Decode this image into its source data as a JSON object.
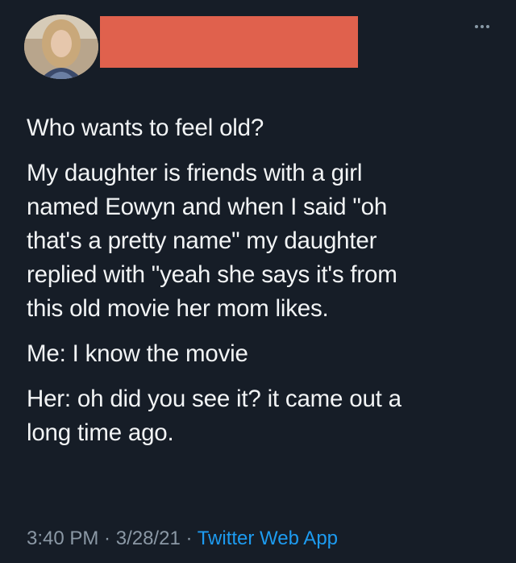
{
  "tweet": {
    "paragraphs": [
      "Who wants to feel old?",
      "My daughter is friends with a girl\nnamed Eowyn and when I said \"oh\nthat's a pretty name\" my daughter\nreplied with \"yeah she says it's from\nthis old movie her mom likes.",
      "Me: I know the movie",
      "Her: oh did you see it? it came out a\nlong time ago."
    ],
    "time": "3:40 PM",
    "separator": " · ",
    "date": "3/28/21",
    "source": "Twitter Web App"
  },
  "colors": {
    "background": "#161d27",
    "text": "#f2f4f5",
    "muted": "#8b98a5",
    "link": "#1d9bf0",
    "redaction": "#e0614d"
  },
  "icons": {
    "more": "more-horizontal-icon"
  }
}
